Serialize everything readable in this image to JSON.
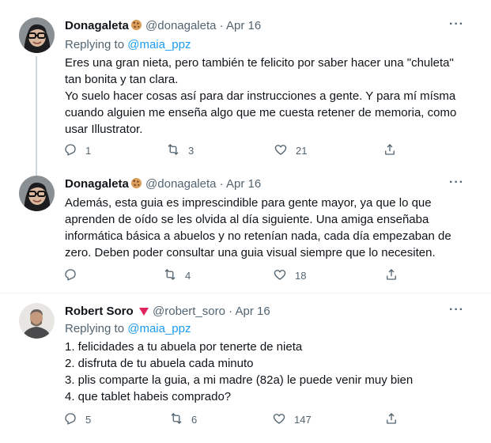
{
  "tweets": [
    {
      "name": "Donagaleta",
      "handle": "@donagaleta",
      "date": "Apr 16",
      "replying_prefix": "Replying to",
      "replying_to": "@maia_ppz",
      "body": [
        "Eres una gran nieta, pero también te felicito por saber hacer una \"chuleta\"",
        "tan bonita y tan clara.",
        "Yo suelo hacer cosas así para dar instrucciones a gente. Y para mí mísma",
        "cuando alguien me enseña algo que me cuesta retener de memoria, como",
        "usar Illustrator."
      ],
      "replies": "1",
      "retweets": "3",
      "likes": "21"
    },
    {
      "name": "Donagaleta",
      "handle": "@donagaleta",
      "date": "Apr 16",
      "body": [
        "Además, esta guia es imprescindible para gente mayor, ya que lo que",
        "aprenden de oído se les olvida al día siguiente. Una amiga enseñaba",
        "informática básica a abuelos y no retenían nada, cada día empezaban de",
        "zero. Deben poder consultar una guia visual siempre que lo necesiten."
      ],
      "replies": "",
      "retweets": "4",
      "likes": "18"
    },
    {
      "name": "Robert Soro",
      "handle": "@robert_soro",
      "date": "Apr 16",
      "replying_prefix": "Replying to",
      "replying_to": "@maia_ppz",
      "body": [
        "1. felicidades a tu abuela por tenerte de nieta",
        "2. disfruta de tu abuela cada minuto",
        "3. plis comparte la guia, a mi madre (82a) le puede venir muy bien",
        "4. que tablet habeis comprado?"
      ],
      "replies": "5",
      "retweets": "6",
      "likes": "147"
    }
  ],
  "separator": "·",
  "more_label": "···",
  "icons": {
    "reply": "reply-icon",
    "retweet": "retweet-icon",
    "like": "heart-icon",
    "share": "share-icon",
    "cookie": "cookie-emoji-icon",
    "red_triangle": "red-triangle-icon"
  },
  "colors": {
    "link": "#1d9bf0",
    "secondary": "#536471",
    "thread_line": "#cfd9de",
    "badge_red": "#e0245e"
  }
}
